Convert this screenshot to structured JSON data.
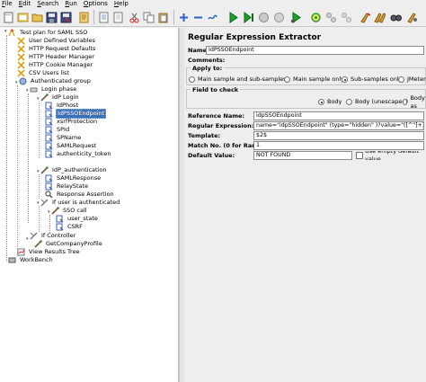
{
  "menu": [
    "File",
    "Edit",
    "Search",
    "Run",
    "Options",
    "Help"
  ],
  "toolbar_icons": [
    "new-icon",
    "templates-icon",
    "open-icon",
    "save-icon",
    "save-as-icon",
    "cut-icon",
    "copy-icon",
    "paste-icon",
    "expand-icon",
    "collapse-icon",
    "toggle-icon",
    "start-icon",
    "start-no-pause-icon",
    "stop-icon",
    "shutdown-icon",
    "remote-start-icon",
    "remote-stop-icon",
    "remote-shutdown-icon",
    "clear-icon",
    "clear-all-icon",
    "search-icon",
    "reset-search-icon"
  ],
  "tree": {
    "nodes": [
      {
        "label": "Test plan for SAML SSO",
        "icon": "testplan-icon"
      },
      {
        "label": "User Defined Variables",
        "icon": "config-icon"
      },
      {
        "label": "HTTP Request Defaults",
        "icon": "config-icon"
      },
      {
        "label": "HTTP Header Manager",
        "icon": "config-icon"
      },
      {
        "label": "HTTP Cookie Manager",
        "icon": "config-icon"
      },
      {
        "label": "CSV Users list",
        "icon": "config-icon"
      },
      {
        "label": "Authenticated group",
        "icon": "thread-group-icon"
      },
      {
        "label": "Login phase",
        "icon": "transaction-icon"
      },
      {
        "label": "IdP Login",
        "icon": "sampler-icon"
      },
      {
        "label": "IdPhost",
        "icon": "extractor-icon"
      },
      {
        "label": "IdPSSOEndpoint",
        "icon": "extractor-icon"
      },
      {
        "label": "xsrfProtection",
        "icon": "extractor-icon"
      },
      {
        "label": "SPId",
        "icon": "extractor-icon"
      },
      {
        "label": "SPName",
        "icon": "extractor-icon"
      },
      {
        "label": "SAMLRequest",
        "icon": "extractor-icon"
      },
      {
        "label": "authenticity_token",
        "icon": "extractor-icon"
      },
      {
        "label": "IdP_authentication",
        "icon": "sampler-icon"
      },
      {
        "label": "SAMLResponse",
        "icon": "extractor-icon"
      },
      {
        "label": "RelayState",
        "icon": "extractor-icon"
      },
      {
        "label": "Response Assertion",
        "icon": "assertion-icon"
      },
      {
        "label": "If user is authenticated",
        "icon": "if-controller-icon"
      },
      {
        "label": "SSO call",
        "icon": "sampler-icon"
      },
      {
        "label": "user_state",
        "icon": "extractor-icon"
      },
      {
        "label": "CSRF",
        "icon": "extractor-icon"
      },
      {
        "label": "If Controller",
        "icon": "if-controller-icon"
      },
      {
        "label": "GetCompanyProfile",
        "icon": "sampler-icon"
      },
      {
        "label": "View Results Tree",
        "icon": "listener-icon"
      },
      {
        "label": "WorkBench",
        "icon": "workbench-icon"
      }
    ]
  },
  "panel": {
    "title": "Regular Expression Extractor",
    "name_label": "Name:",
    "name_value": "IdPSSOEndpoint",
    "comments_label": "Comments:",
    "apply_to_legend": "Apply to:",
    "apply_options": [
      "Main sample and sub-samples",
      "Main sample only",
      "Sub-samples only",
      "JMeter"
    ],
    "apply_selected": 2,
    "field_legend": "Field to check",
    "field_options": [
      "Body",
      "Body (unescaped)",
      "Body as"
    ],
    "field_selected": 0,
    "ref_label": "Reference Name:",
    "ref_value": "idpSSOEndpoint",
    "regex_label": "Regular Expression:",
    "regex_value": "name=\"idpSSOEndpoint\" (type=\"hidden\" )?value=\"([^\"]+)\"",
    "template_label": "Template:",
    "template_value": "$2$",
    "match_label": "Match No. (0 for Random):",
    "match_value": "1",
    "default_label": "Default Value:",
    "default_value": "NOT FOUND",
    "empty_default_label": "Use empty default value"
  }
}
